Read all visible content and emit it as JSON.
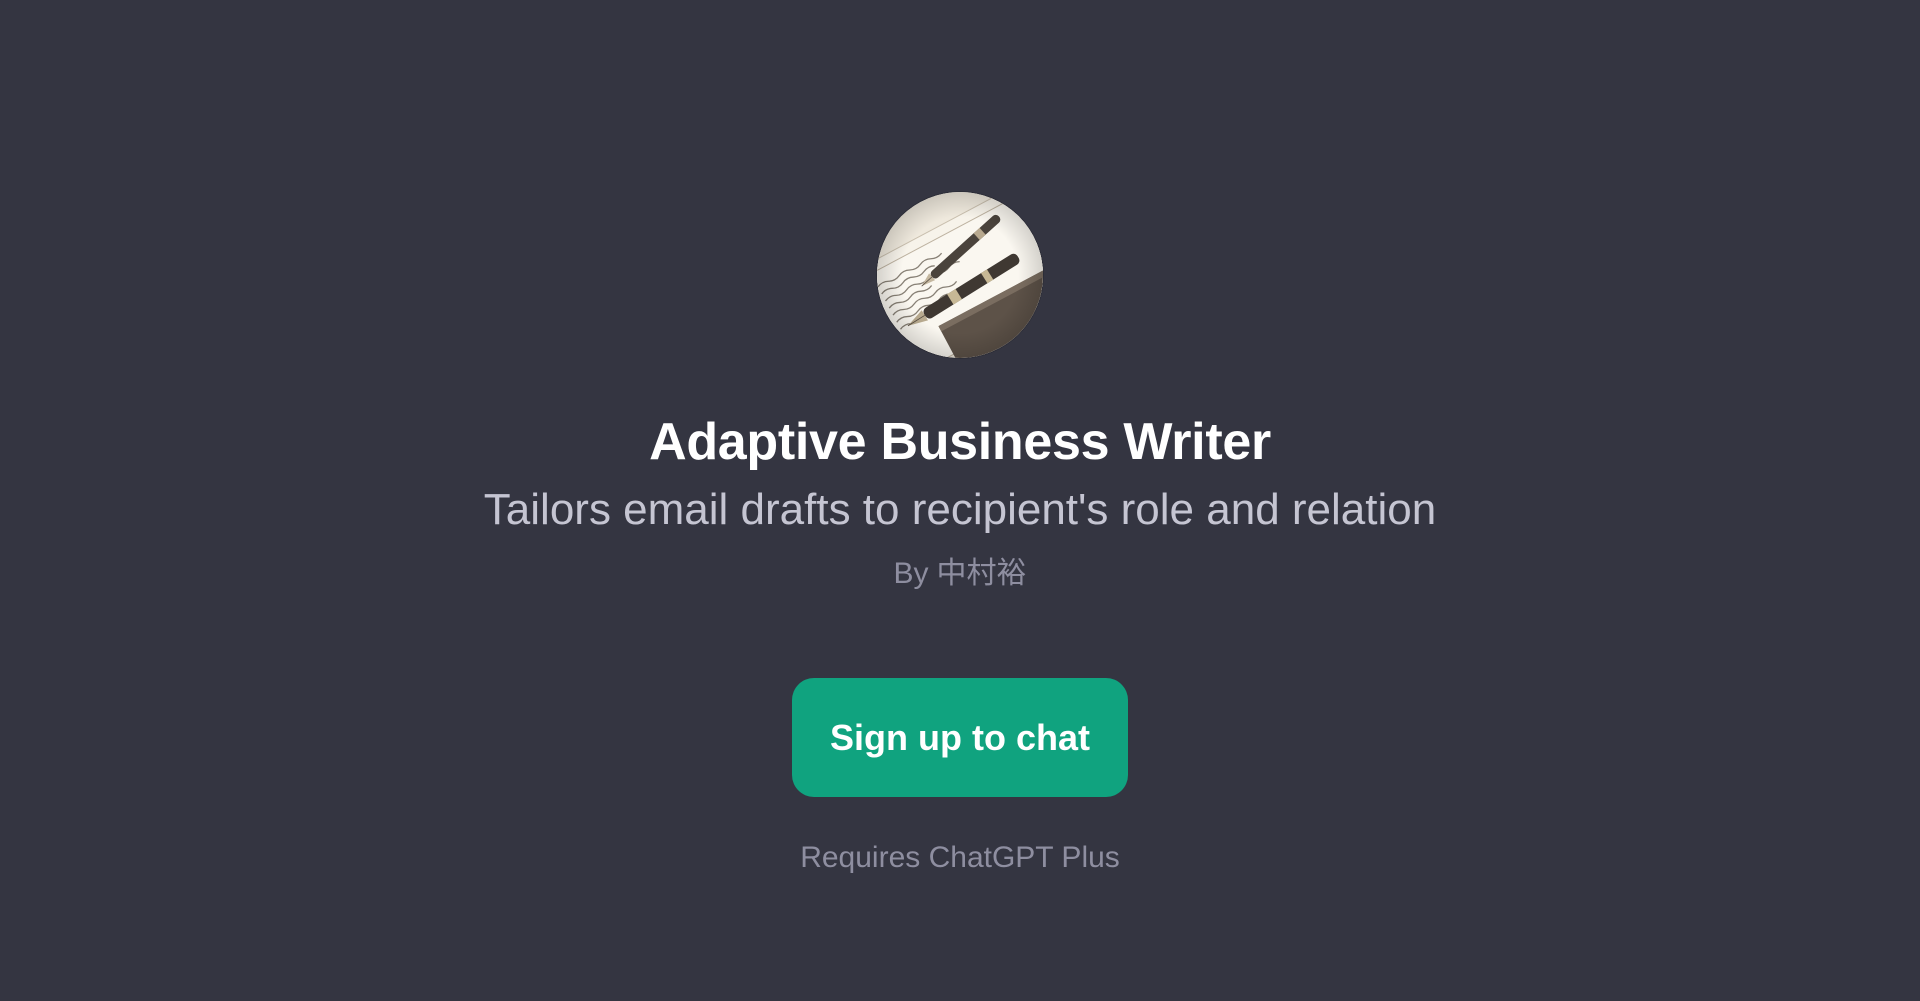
{
  "gpt": {
    "title": "Adaptive Business Writer",
    "description": "Tailors email drafts to recipient's role and relation",
    "by_prefix": "By",
    "author": "中村裕",
    "avatar_icon": "fountain-pen-letter-icon"
  },
  "cta": {
    "signup_label": "Sign up to chat",
    "requires_text": "Requires ChatGPT Plus"
  },
  "colors": {
    "background": "#343541",
    "accent": "#10a37f",
    "title": "#ffffff",
    "subtitle": "#c5c5d2",
    "muted": "#8e8ea0"
  }
}
